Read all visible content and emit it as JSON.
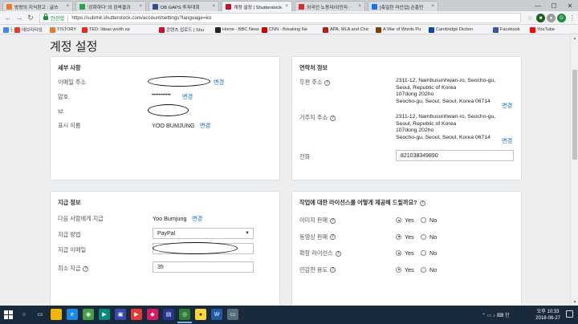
{
  "browser": {
    "tabs": [
      {
        "label": "방랑의 지식창고 : 글쓰",
        "color": "#e57a2e"
      },
      {
        "label": "'강화하다' 의 검색결과",
        "color": "#2e9e4f"
      },
      {
        "label": "DB GAPS 투자대회",
        "color": "#2d4f8e"
      },
      {
        "label": "계정 설정 | Shutterstock",
        "color": "#c8102e"
      },
      {
        "label": "외국인 노동자/이민자 ·",
        "color": "#d32f2f"
      },
      {
        "label": "[축일한 라인업] 손흥민",
        "color": "#1a73e8"
      }
    ],
    "active_tab": 3,
    "close_glyph": "×",
    "window_controls": {
      "minimize": "—",
      "maximize": "☐",
      "close": "✕"
    },
    "nav": {
      "back": "←",
      "forward": "→",
      "reload": "↻"
    },
    "address": {
      "secure_label": "안전함",
      "url": "https://submit.shutterstock.com/account/settings?language=ko"
    },
    "toolbar_icons": [
      {
        "name": "star-icon",
        "glyph": "☆",
        "color": "#888888"
      },
      {
        "name": "extension-icon",
        "glyph": "■",
        "color": "#1b5e20"
      },
      {
        "name": "extension-icon-2",
        "glyph": "●",
        "color": "#9e9e9e"
      },
      {
        "name": "extension-icon-3",
        "glyph": "G",
        "color": "#1e8e3e"
      },
      {
        "name": "menu-icon",
        "glyph": "⋮",
        "color": "#666666"
      }
    ],
    "bookmarks": [
      {
        "label": "앱",
        "color": "#4285f4"
      },
      {
        "label": "애브리타임",
        "color": "#e53935"
      },
      {
        "label": "TISTORY",
        "color": "#e57a2e"
      },
      {
        "label": "TED: Ideas worth sp",
        "color": "#e62b1e"
      },
      {
        "label": "콘텐츠 업로드 | Shu",
        "color": "#c8102e"
      },
      {
        "label": "Home - BBC News",
        "color": "#222222"
      },
      {
        "label": "CNN - Breaking Ne",
        "color": "#cc0000"
      },
      {
        "label": "APA, MLA and Chic",
        "color": "#b71c1c"
      },
      {
        "label": "A War of Words Pu",
        "color": "#7b3f00"
      },
      {
        "label": "Cambridge Diction",
        "color": "#0d47a1"
      },
      {
        "label": "Facebook",
        "color": "#3b5998"
      },
      {
        "label": "YouTube",
        "color": "#ff0000"
      }
    ]
  },
  "page": {
    "title": "계정 설정",
    "help_glyph": "?",
    "details": {
      "heading": "세부 사항",
      "email_label": "이메일 주소",
      "email_link": "변경",
      "password_label": "암호",
      "password_value": "•••••••••••",
      "password_link": "변경",
      "id_label": "Id:",
      "display_name_label": "표시 이름",
      "display_name_value": "YOO BUMJUNG",
      "display_name_link": "변경"
    },
    "contact": {
      "heading": "연락처 정보",
      "mailing_label": "우편 주소",
      "mailing_lines": [
        "2311-12, Nambusunhwan-ro, Seocho-gu,",
        "Seoul, Republic of Korea",
        "107dong 202ho",
        "Seocho-gu, Seoul, Seoul, Korea 06714"
      ],
      "mailing_link": "변경",
      "residence_label": "거주지 주소",
      "residence_lines": [
        "2311-12, Nambusunhwan-ro, Seocho-gu,",
        "Seoul, Republic of Korea",
        "107dong 202ho",
        "Seocho-gu, Seoul, Seoul, Korea 06714"
      ],
      "residence_link": "변경",
      "phone_label": "전화",
      "phone_value": "821038349890"
    },
    "payment": {
      "heading": "지급 정보",
      "payee_label": "다음 사람에게 지급",
      "payee_value": "Yoo Bumjung",
      "payee_link": "변경",
      "method_label": "지급 방법",
      "method_value": "PayPal",
      "email_label": "지급 이메일",
      "minimum_label": "최소 지급",
      "minimum_value": "35"
    },
    "licensing": {
      "heading": "작업에 대한 라이선스를 어떻게 제공해 드릴까요?",
      "rows": [
        {
          "label": "이미지 판매",
          "selected": "Yes"
        },
        {
          "label": "동영상 판매",
          "selected": "Yes"
        },
        {
          "label": "확장 라이선스",
          "selected": "Yes"
        },
        {
          "label": "민감한 용도",
          "selected": "Yes"
        }
      ],
      "yes_label": "Yes",
      "no_label": "No"
    }
  },
  "taskbar": {
    "apps": [
      {
        "name": "search-icon",
        "color": "#1a2a3d",
        "glyph": "○"
      },
      {
        "name": "task-view-icon",
        "color": "#1a2a3d",
        "glyph": "▭"
      },
      {
        "name": "file-explorer-icon",
        "color": "#f5b400",
        "glyph": ""
      },
      {
        "name": "edge-icon",
        "color": "#1e88e5",
        "glyph": "e"
      },
      {
        "name": "app-icon-green",
        "color": "#43a047",
        "glyph": "◉"
      },
      {
        "name": "app-icon-teal",
        "color": "#00897b",
        "glyph": "▶"
      },
      {
        "name": "app-icon-blue",
        "color": "#3949ab",
        "glyph": "▣"
      },
      {
        "name": "media-icon",
        "color": "#e53935",
        "glyph": "▶"
      },
      {
        "name": "app-icon-pink",
        "color": "#d81b60",
        "glyph": "◆"
      },
      {
        "name": "app-icon-navy",
        "color": "#283593",
        "glyph": "▤"
      },
      {
        "name": "chrome-icon",
        "color": "#2e7d32",
        "glyph": "◎"
      },
      {
        "name": "kakao-icon",
        "color": "#fdd835",
        "glyph": "●"
      },
      {
        "name": "word-icon",
        "color": "#1e5aa8",
        "glyph": "W"
      },
      {
        "name": "app-icon-gray",
        "color": "#546e7a",
        "glyph": "▭"
      }
    ],
    "tray": "⌃  ▭  ♪  ⌨  한",
    "time": "오후 10:33",
    "date": "2018-06-27"
  }
}
